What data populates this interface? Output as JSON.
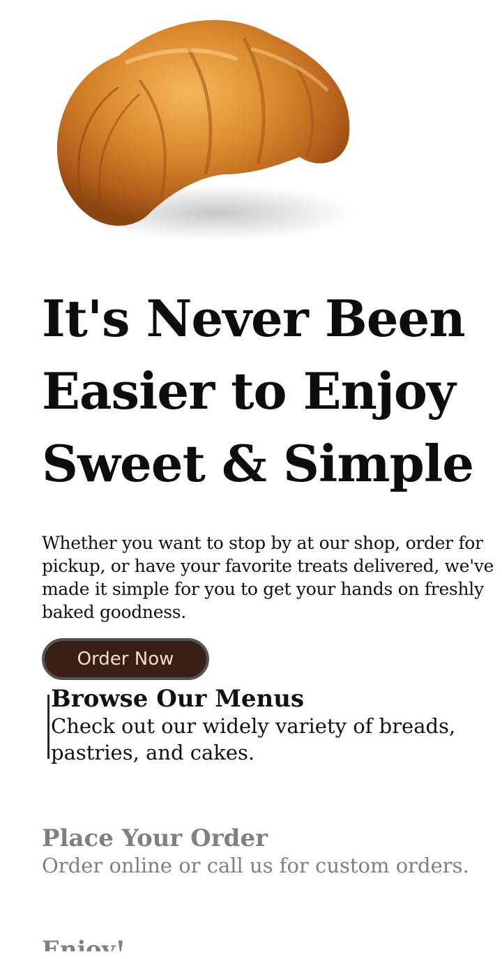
{
  "hero": {
    "image_subject": "croissant"
  },
  "headline": {
    "lines": [
      "It's Never Been",
      "Easier to Enjoy",
      "Sweet & Simple"
    ]
  },
  "intro": {
    "text": "Whether you want to stop by at our shop, order for pickup, or have your favorite treats delivered, we've made it simple for you to get your hands on freshly baked goodness."
  },
  "cta": {
    "label": "Order Now"
  },
  "steps": [
    {
      "title": "Browse Our Menus",
      "description": "Check out our widely variety of breads, pastries, and cakes.",
      "active": true
    },
    {
      "title": "Place Your Order",
      "description": "Order online or call us for custom orders.",
      "active": false
    },
    {
      "title": "Enjoy!",
      "active": false
    }
  ],
  "colors": {
    "brand_dark": "#3a1f17",
    "button_text": "#f7dcc8",
    "muted_text": "#808080",
    "heading_text": "#0d0d0d"
  }
}
